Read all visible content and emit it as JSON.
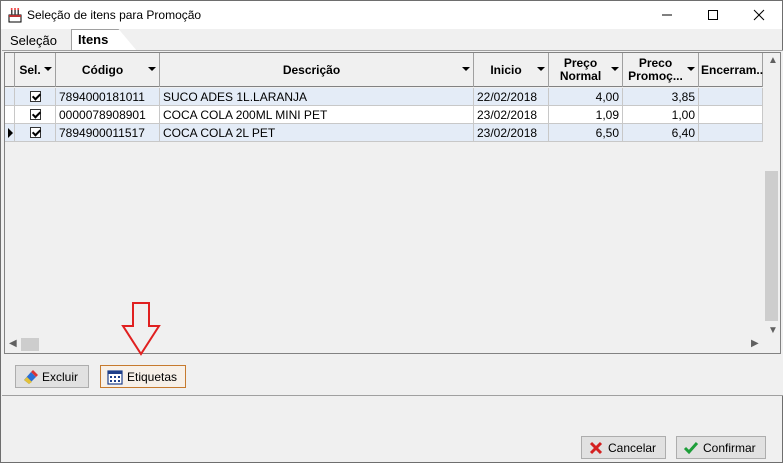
{
  "window": {
    "title": "Seleção de itens para Promoção",
    "icons": {
      "app": "cake-icon",
      "minimize": "minimize-icon",
      "maximize": "maximize-icon",
      "close": "close-icon"
    }
  },
  "tabs": [
    {
      "label": "Seleção",
      "active": false
    },
    {
      "label": "Itens",
      "active": true
    }
  ],
  "grid": {
    "columns": [
      {
        "key": "sel",
        "label": "Sel.",
        "dropdown": true
      },
      {
        "key": "codigo",
        "label": "Código",
        "dropdown": true
      },
      {
        "key": "descricao",
        "label": "Descrição",
        "dropdown": true
      },
      {
        "key": "inicio",
        "label": "Inicio",
        "dropdown": true
      },
      {
        "key": "preco_normal",
        "label": "Preço Normal",
        "dropdown": true
      },
      {
        "key": "preco_promocao",
        "label": "Preco Promoç...",
        "dropdown": true
      },
      {
        "key": "encerramento",
        "label": "Encerram...",
        "dropdown": false
      }
    ],
    "rows": [
      {
        "sel": true,
        "codigo": "7894000181011",
        "descricao": "SUCO ADES 1L.LARANJA",
        "inicio": "22/02/2018",
        "preco_normal": "4,00",
        "preco_promocao": "3,85",
        "encerramento": "",
        "current": false
      },
      {
        "sel": true,
        "codigo": "0000078908901",
        "descricao": "COCA COLA 200ML MINI PET",
        "inicio": "23/02/2018",
        "preco_normal": "1,09",
        "preco_promocao": "1,00",
        "encerramento": "",
        "current": false
      },
      {
        "sel": true,
        "codigo": "7894900011517",
        "descricao": "COCA COLA 2L PET",
        "inicio": "23/02/2018",
        "preco_normal": "6,50",
        "preco_promocao": "6,40",
        "encerramento": "",
        "current": true
      }
    ]
  },
  "buttons": {
    "excluir": {
      "label": "Excluir",
      "icon": "eraser-icon"
    },
    "etiquetas": {
      "label": "Etiquetas",
      "icon": "calendar-icon"
    },
    "cancelar": {
      "label": "Cancelar",
      "icon": "x-icon"
    },
    "confirmar": {
      "label": "Confirmar",
      "icon": "checkmark-icon"
    }
  },
  "annotation": {
    "icon": "down-arrow-icon",
    "color": "#e02020"
  },
  "colors": {
    "alt_row": "#e4ecf7",
    "focus_border": "#c67a2e"
  }
}
